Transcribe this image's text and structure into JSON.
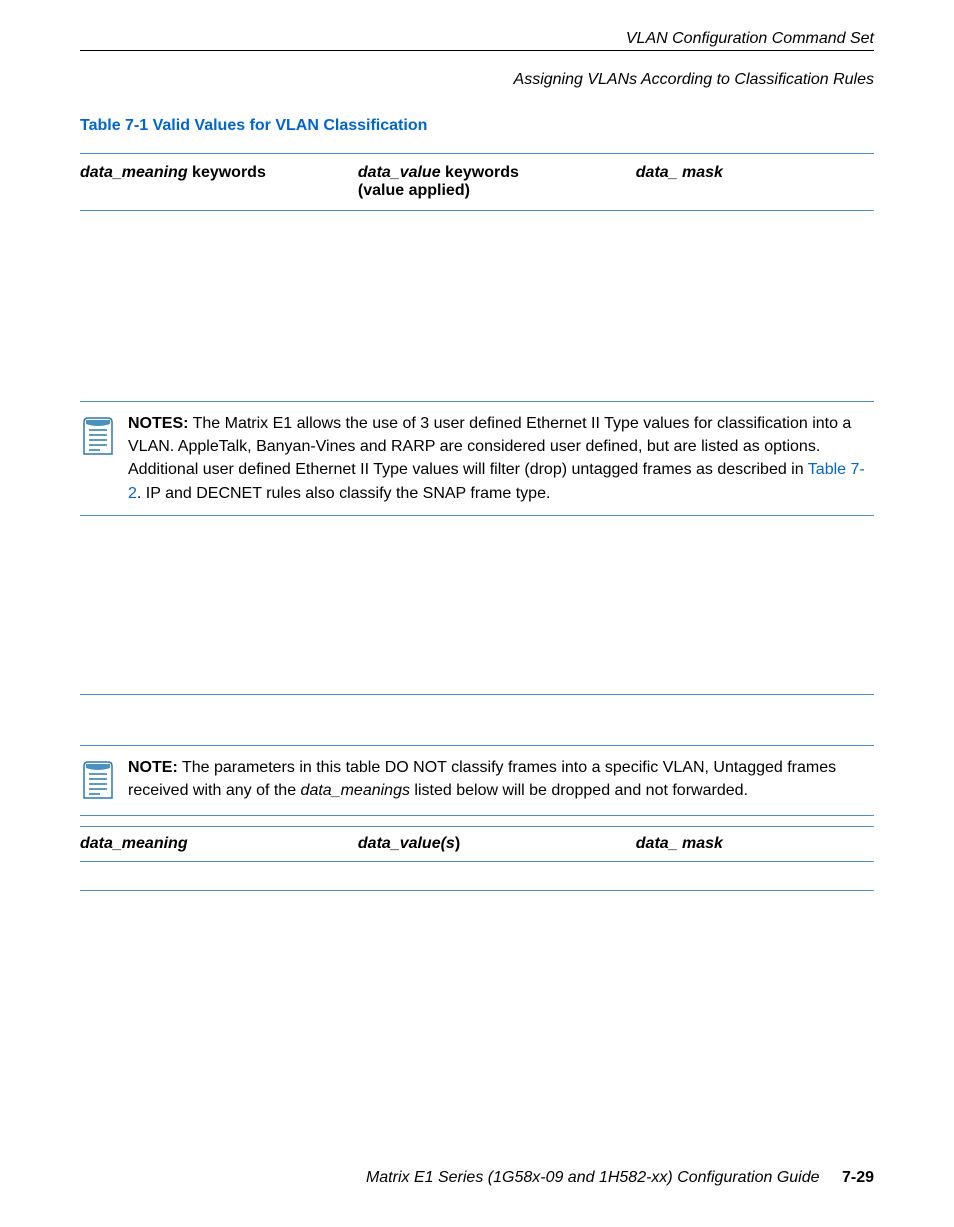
{
  "header": {
    "line1": "VLAN Configuration Command Set",
    "line2": "Assigning VLANs According to Classification Rules"
  },
  "table1": {
    "caption": "Table 7-1    Valid Values for VLAN Classification",
    "headers": {
      "col1_italic": "data_meaning",
      "col1_rest": " keywords",
      "col2_italic": "data_value",
      "col2_rest_line1": " keywords",
      "col2_line2": "(value applied)",
      "col3_italic": "data_ mask"
    }
  },
  "note1": {
    "label": "NOTES:",
    "text_part1": "  The Matrix E1 allows the use of 3 user defined Ethernet II Type values for classification into a VLAN. AppleTalk, Banyan-Vines and RARP are considered user defined, but are listed as options. Additional user defined Ethernet II Type values will filter (drop) untagged frames as described in ",
    "link": "Table 7-2",
    "text_part2": ". IP and DECNET rules also classify the SNAP frame type."
  },
  "note2": {
    "label": "NOTE:",
    "text_part1": "  The parameters in this table DO NOT classify frames into a specific VLAN, Untagged frames received with any of the ",
    "italic_term": "data_meanings",
    "text_part2": " listed below will be dropped and not forwarded."
  },
  "table2": {
    "headers": {
      "col1": "data_meaning",
      "col2_italic": "data_value(s",
      "col2_suffix": ")",
      "col3": "data_ mask"
    }
  },
  "footer": {
    "text": "Matrix E1 Series (1G58x-09 and 1H582-xx) Configuration Guide",
    "pagenum": "7-29"
  }
}
